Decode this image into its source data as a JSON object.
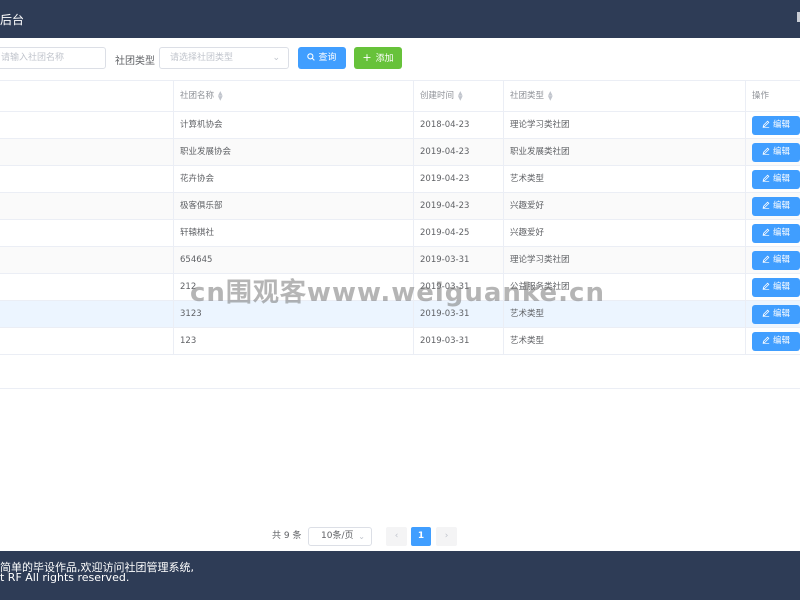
{
  "header": {
    "title": "后台"
  },
  "toolbar": {
    "name_placeholder": "请输入社团名称",
    "type_label": "社团类型",
    "type_placeholder": "请选择社团类型",
    "search_label": "查询",
    "add_label": "添加"
  },
  "table": {
    "columns": [
      "社团名称",
      "创建时间",
      "社团类型",
      "操作"
    ],
    "edit_label": "编辑",
    "rows": [
      {
        "name": "计算机协会",
        "date": "2018-04-23",
        "type": "理论学习类社团"
      },
      {
        "name": "职业发展协会",
        "date": "2019-04-23",
        "type": "职业发展类社团"
      },
      {
        "name": "花卉协会",
        "date": "2019-04-23",
        "type": "艺术类型"
      },
      {
        "name": "极客俱乐部",
        "date": "2019-04-23",
        "type": "兴趣爱好"
      },
      {
        "name": "轩辕棋社",
        "date": "2019-04-25",
        "type": "兴趣爱好"
      },
      {
        "name": "654645",
        "date": "2019-03-31",
        "type": "理论学习类社团"
      },
      {
        "name": "212",
        "date": "2019-03-31",
        "type": "公益服务类社团"
      },
      {
        "name": "3123",
        "date": "2019-03-31",
        "type": "艺术类型"
      },
      {
        "name": "123",
        "date": "2019-03-31",
        "type": "艺术类型"
      }
    ]
  },
  "pagination": {
    "total": "共 9 条",
    "page_size": "10条/页",
    "current_page": "1",
    "prev": "‹",
    "next": "›"
  },
  "footer": {
    "line1": "简单的毕设作品,欢迎访问社团管理系统,",
    "line2": "t RF All rights reserved."
  },
  "watermark": "cn围观客www.weiguanke.cn",
  "colors": {
    "header_bg": "#2e3c56",
    "primary": "#409eff",
    "success": "#67c23a",
    "hover_row": "#ecf5ff"
  }
}
